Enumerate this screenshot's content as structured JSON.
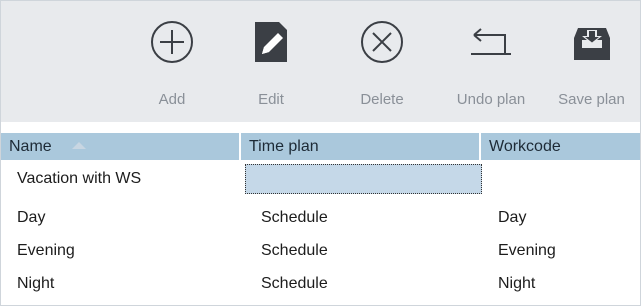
{
  "toolbar": {
    "add_label": "Add",
    "edit_label": "Edit",
    "delete_label": "Delete",
    "undo_label": "Undo plan",
    "save_label": "Save plan"
  },
  "columns": {
    "name": "Name",
    "timeplan": "Time plan",
    "workcode": "Workcode"
  },
  "rows": [
    {
      "name": "Vacation with WS",
      "timeplan": "",
      "workcode": ""
    },
    {
      "name": "Day",
      "timeplan": "Schedule",
      "workcode": "Day"
    },
    {
      "name": "Evening",
      "timeplan": "Schedule",
      "workcode": "Evening"
    },
    {
      "name": "Night",
      "timeplan": "Schedule",
      "workcode": "Night"
    }
  ],
  "colors": {
    "toolbar_bg": "#e8eaed",
    "header_bg": "#aac8dc",
    "edit_cell_bg": "#c5d8e8",
    "icon_color": "#3b3f45"
  }
}
